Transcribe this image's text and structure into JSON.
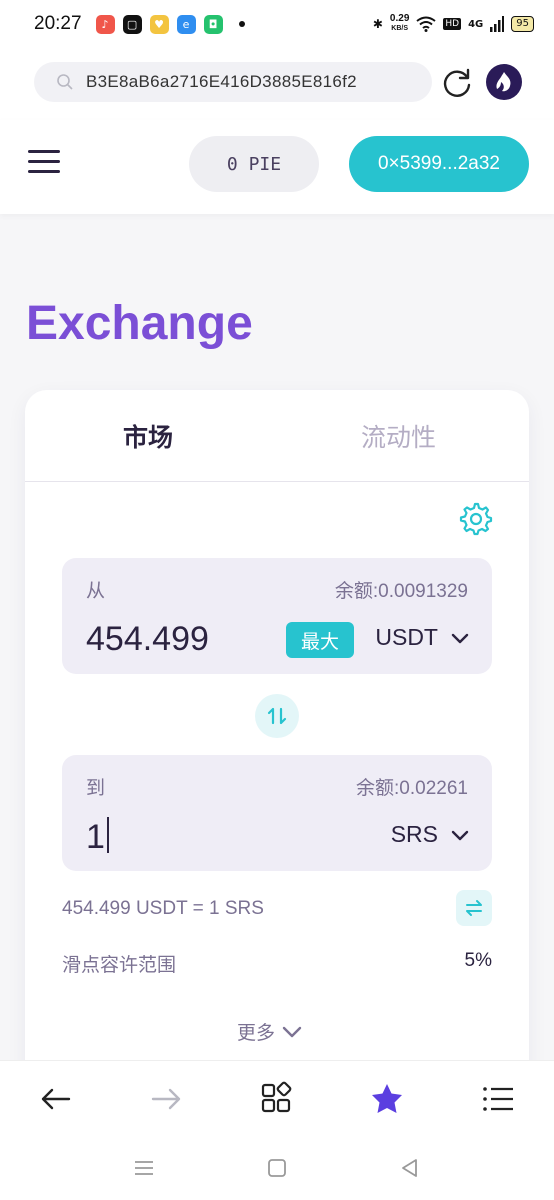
{
  "statusbar": {
    "time": "20:27",
    "speed_value": "0.29",
    "speed_unit": "KB/S",
    "hd": "HD",
    "network": "4G",
    "battery": "95"
  },
  "browser": {
    "url": "B3E8aB6a2716E416D3885E816f2"
  },
  "header": {
    "balance": "0 PIE",
    "address": "0×5399...2a32"
  },
  "page": {
    "title": "Exchange"
  },
  "tabs": {
    "market": "市场",
    "liquidity": "流动性"
  },
  "from": {
    "label": "从",
    "balance": "余额:0.0091329",
    "amount": "454.499",
    "max_label": "最大",
    "token": "USDT"
  },
  "to": {
    "label": "到",
    "balance": "余额:0.02261",
    "amount": "1",
    "token": "SRS"
  },
  "info": {
    "rate": "454.499 USDT = 1 SRS",
    "slippage_label": "滑点容许范围",
    "slippage_value": "5%",
    "more_label": "更多"
  },
  "colors": {
    "accent": "#27c3cf",
    "title": "#7b4fd6",
    "active_nav": "#5b3fe0"
  }
}
